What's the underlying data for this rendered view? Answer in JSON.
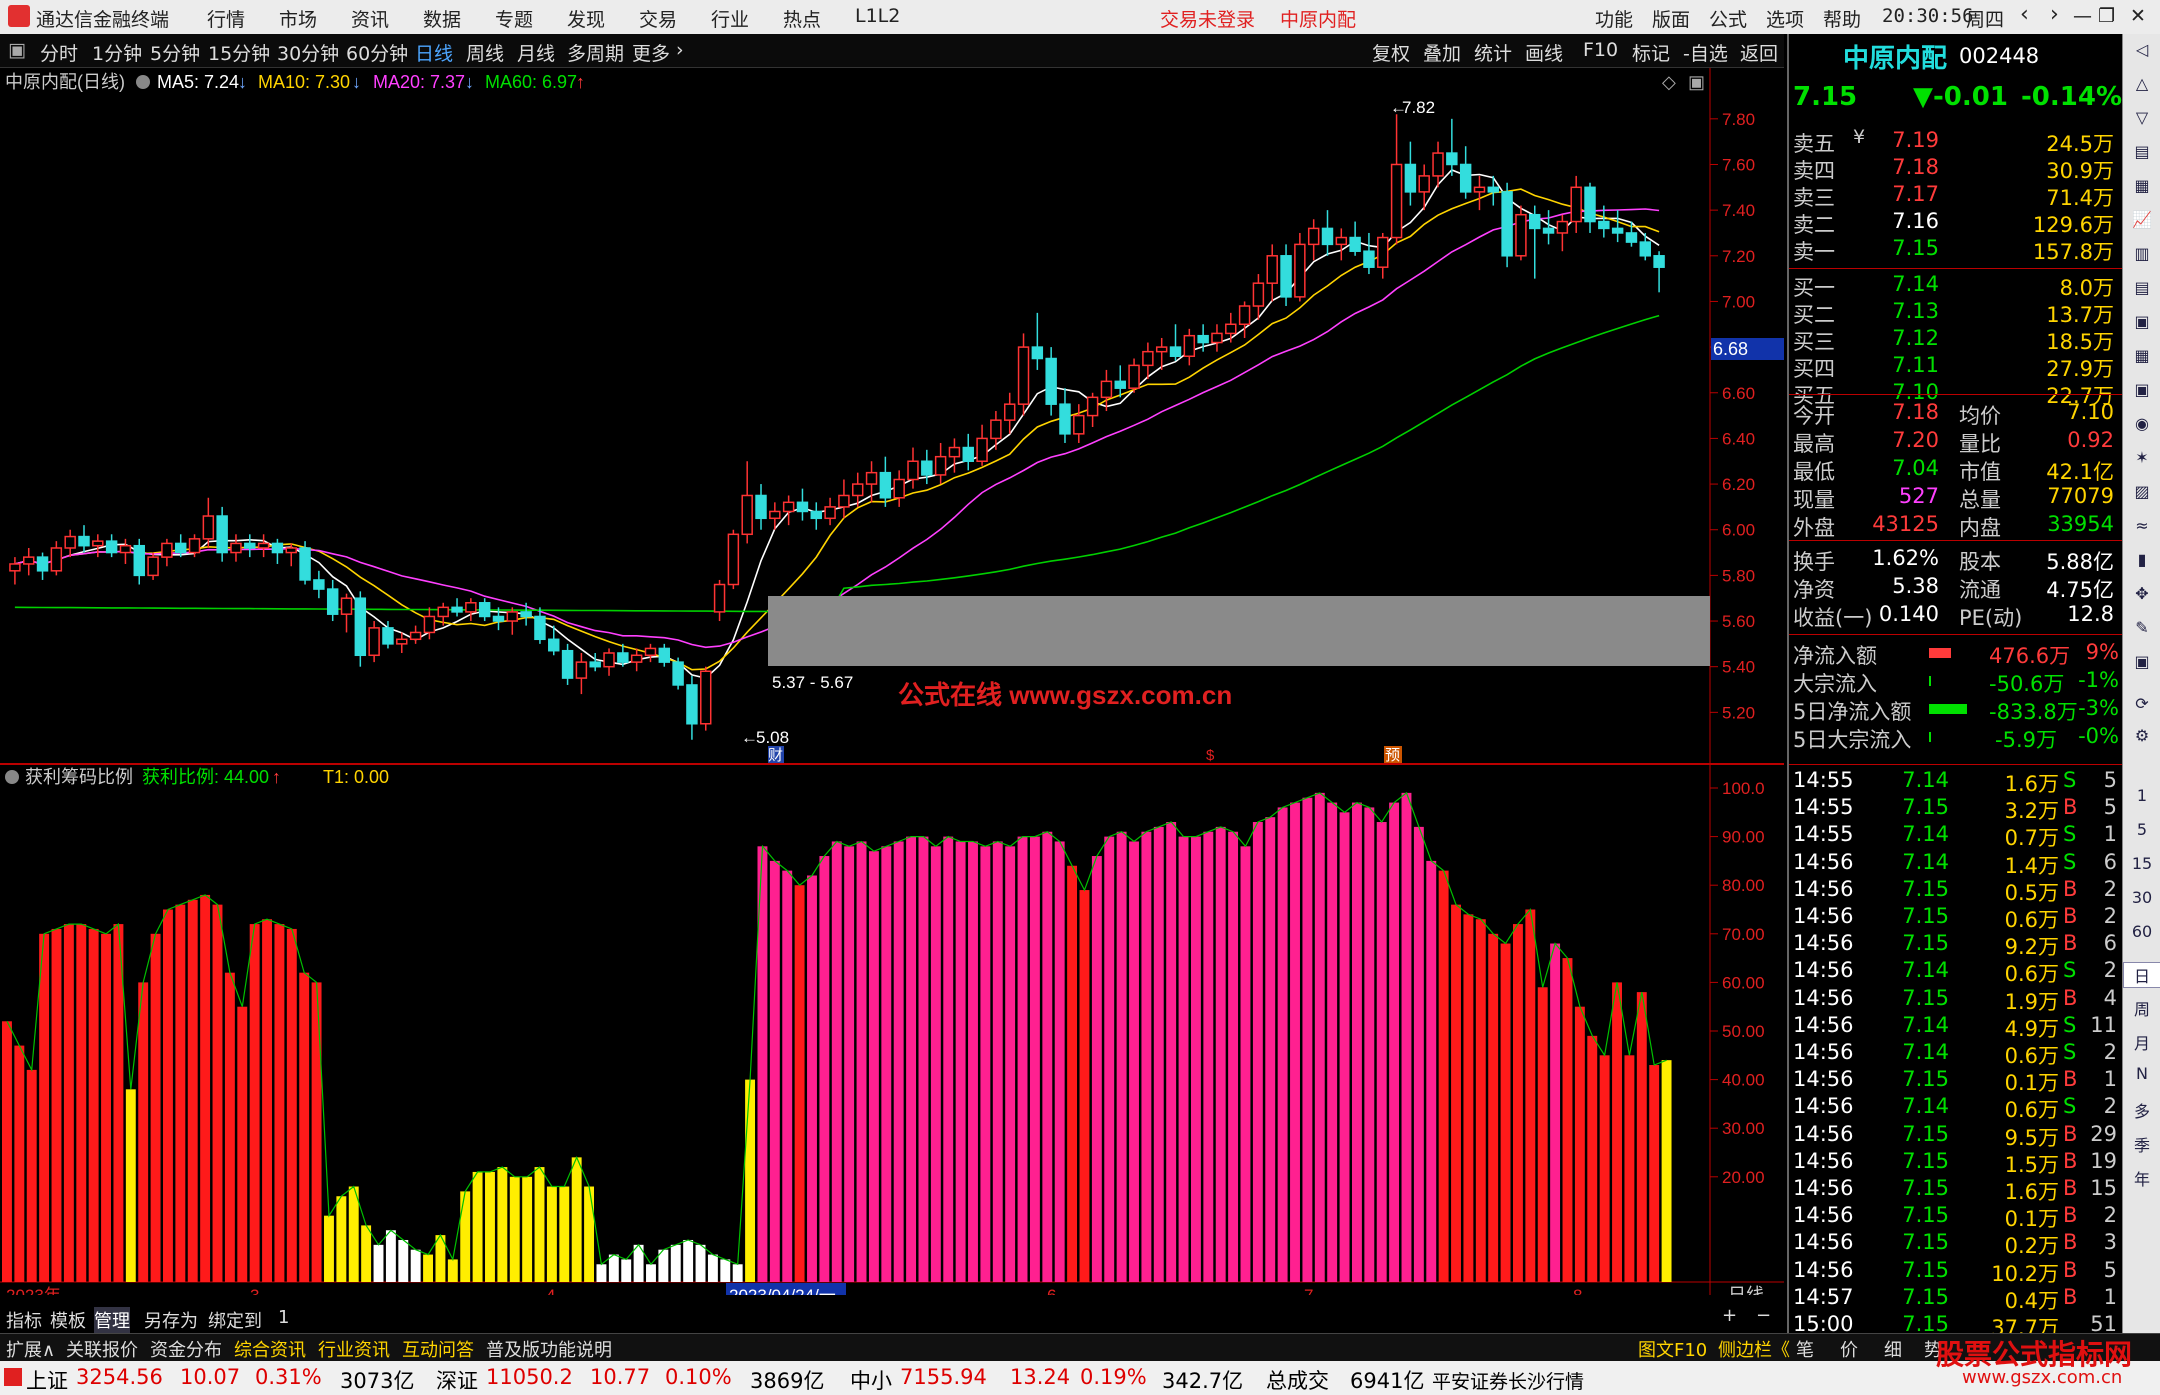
{
  "app": {
    "title": "通达信金融终端",
    "menus": [
      "行情",
      "市场",
      "资讯",
      "数据",
      "专题",
      "发现",
      "交易",
      "行业",
      "热点",
      "L1L2"
    ],
    "login": "交易未登录",
    "stock_name_title": "中原内配",
    "right_menus": [
      "功能",
      "版面",
      "公式",
      "选项",
      "帮助"
    ],
    "time": "20:30:56",
    "weekday": "周四"
  },
  "periods": [
    "分时",
    "1分钟",
    "5分钟",
    "15分钟",
    "30分钟",
    "60分钟",
    "日线",
    "周线",
    "月线",
    "多周期",
    "更多"
  ],
  "active_period": "日线",
  "chart_buttons": [
    "复权",
    "叠加",
    "统计",
    "画线",
    "F10",
    "标记",
    "-自选",
    "返回"
  ],
  "ma_legend": {
    "name": "中原内配(日线)",
    "ma5": "MA5: 7.24",
    "ma10": "MA10: 7.30",
    "ma20": "MA20: 7.37",
    "ma60": "MA60: 6.97"
  },
  "price_axis": [
    "7.80",
    "7.60",
    "7.40",
    "7.20",
    "7.00",
    "6.80",
    "6.60",
    "6.40",
    "6.20",
    "6.00",
    "5.80",
    "5.60",
    "5.40",
    "5.20"
  ],
  "price_marker": "6.68",
  "annotations": {
    "high": "7.82",
    "low": "5.08",
    "range": "5.37 - 5.67",
    "watermark": "公式在线  www.gszx.com.cn",
    "markers": [
      "财",
      "$",
      "预"
    ]
  },
  "indicator": {
    "name": "获利筹码比例",
    "value": "获利比例: 44.00",
    "t1": "T1: 0.00",
    "axis": [
      "100.0",
      "90.00",
      "80.00",
      "70.00",
      "60.00",
      "50.00",
      "40.00",
      "30.00",
      "20.00"
    ]
  },
  "date_axis": {
    "labels": [
      "2023年",
      "3",
      "4",
      "2023/04/24/一",
      "6",
      "7",
      "8"
    ],
    "period": "日线"
  },
  "chart_bottom_tabs": [
    "指标",
    "模板",
    "管理",
    "另存为",
    "绑定到",
    "1"
  ],
  "chart_data": {
    "type": "candlestick",
    "title": "中原内配(日线)",
    "ylim": [
      5.0,
      7.9
    ],
    "candles": [
      [
        5.82,
        5.88,
        5.76,
        5.85
      ],
      [
        5.85,
        5.92,
        5.8,
        5.88
      ],
      [
        5.88,
        5.9,
        5.78,
        5.82
      ],
      [
        5.82,
        5.95,
        5.8,
        5.92
      ],
      [
        5.92,
        6.0,
        5.88,
        5.97
      ],
      [
        5.97,
        6.02,
        5.9,
        5.93
      ],
      [
        5.93,
        5.98,
        5.88,
        5.95
      ],
      [
        5.95,
        5.98,
        5.88,
        5.9
      ],
      [
        5.9,
        5.96,
        5.85,
        5.93
      ],
      [
        5.93,
        5.96,
        5.76,
        5.8
      ],
      [
        5.8,
        5.9,
        5.78,
        5.88
      ],
      [
        5.88,
        5.96,
        5.84,
        5.94
      ],
      [
        5.94,
        5.98,
        5.88,
        5.9
      ],
      [
        5.9,
        5.98,
        5.88,
        5.96
      ],
      [
        5.96,
        6.14,
        5.92,
        6.06
      ],
      [
        6.06,
        6.1,
        5.86,
        5.9
      ],
      [
        5.9,
        5.98,
        5.86,
        5.94
      ],
      [
        5.94,
        5.98,
        5.88,
        5.92
      ],
      [
        5.92,
        5.98,
        5.88,
        5.94
      ],
      [
        5.94,
        5.96,
        5.85,
        5.9
      ],
      [
        5.9,
        5.94,
        5.84,
        5.92
      ],
      [
        5.92,
        5.95,
        5.76,
        5.78
      ],
      [
        5.78,
        5.82,
        5.7,
        5.74
      ],
      [
        5.74,
        5.78,
        5.6,
        5.63
      ],
      [
        5.63,
        5.72,
        5.55,
        5.7
      ],
      [
        5.7,
        5.73,
        5.4,
        5.45
      ],
      [
        5.45,
        5.6,
        5.42,
        5.57
      ],
      [
        5.57,
        5.6,
        5.48,
        5.5
      ],
      [
        5.5,
        5.55,
        5.46,
        5.52
      ],
      [
        5.52,
        5.58,
        5.5,
        5.55
      ],
      [
        5.55,
        5.66,
        5.52,
        5.62
      ],
      [
        5.62,
        5.68,
        5.58,
        5.66
      ],
      [
        5.66,
        5.7,
        5.62,
        5.64
      ],
      [
        5.64,
        5.7,
        5.6,
        5.68
      ],
      [
        5.68,
        5.7,
        5.6,
        5.62
      ],
      [
        5.62,
        5.66,
        5.56,
        5.6
      ],
      [
        5.6,
        5.66,
        5.54,
        5.64
      ],
      [
        5.64,
        5.68,
        5.58,
        5.62
      ],
      [
        5.62,
        5.66,
        5.5,
        5.52
      ],
      [
        5.52,
        5.58,
        5.45,
        5.47
      ],
      [
        5.47,
        5.5,
        5.32,
        5.35
      ],
      [
        5.35,
        5.46,
        5.28,
        5.42
      ],
      [
        5.42,
        5.46,
        5.38,
        5.4
      ],
      [
        5.4,
        5.48,
        5.36,
        5.46
      ],
      [
        5.46,
        5.5,
        5.4,
        5.42
      ],
      [
        5.42,
        5.48,
        5.38,
        5.45
      ],
      [
        5.45,
        5.5,
        5.42,
        5.48
      ],
      [
        5.48,
        5.5,
        5.4,
        5.42
      ],
      [
        5.42,
        5.44,
        5.3,
        5.32
      ],
      [
        5.32,
        5.36,
        5.08,
        5.15
      ],
      [
        5.15,
        5.4,
        5.12,
        5.38
      ],
      [
        5.64,
        5.78,
        5.6,
        5.76
      ],
      [
        5.76,
        6.0,
        5.74,
        5.98
      ],
      [
        5.98,
        6.3,
        5.94,
        6.15
      ],
      [
        6.15,
        6.2,
        6.0,
        6.05
      ],
      [
        6.05,
        6.12,
        6.0,
        6.08
      ],
      [
        6.08,
        6.15,
        6.02,
        6.12
      ],
      [
        6.12,
        6.18,
        6.04,
        6.08
      ],
      [
        6.08,
        6.12,
        6.0,
        6.05
      ],
      [
        6.05,
        6.14,
        6.02,
        6.1
      ],
      [
        6.1,
        6.22,
        6.05,
        6.15
      ],
      [
        6.15,
        6.25,
        6.1,
        6.2
      ],
      [
        6.2,
        6.3,
        6.12,
        6.25
      ],
      [
        6.25,
        6.32,
        6.1,
        6.14
      ],
      [
        6.14,
        6.26,
        6.1,
        6.22
      ],
      [
        6.22,
        6.36,
        6.18,
        6.3
      ],
      [
        6.3,
        6.35,
        6.2,
        6.24
      ],
      [
        6.24,
        6.38,
        6.2,
        6.32
      ],
      [
        6.32,
        6.4,
        6.25,
        6.36
      ],
      [
        6.36,
        6.42,
        6.26,
        6.3
      ],
      [
        6.3,
        6.46,
        6.28,
        6.4
      ],
      [
        6.4,
        6.52,
        6.35,
        6.48
      ],
      [
        6.48,
        6.6,
        6.42,
        6.55
      ],
      [
        6.55,
        6.86,
        6.5,
        6.8
      ],
      [
        6.8,
        6.95,
        6.7,
        6.75
      ],
      [
        6.75,
        6.8,
        6.5,
        6.55
      ],
      [
        6.55,
        6.62,
        6.38,
        6.42
      ],
      [
        6.42,
        6.55,
        6.38,
        6.5
      ],
      [
        6.5,
        6.6,
        6.45,
        6.58
      ],
      [
        6.58,
        6.7,
        6.52,
        6.65
      ],
      [
        6.65,
        6.72,
        6.58,
        6.62
      ],
      [
        6.62,
        6.75,
        6.6,
        6.72
      ],
      [
        6.72,
        6.82,
        6.66,
        6.78
      ],
      [
        6.78,
        6.84,
        6.7,
        6.8
      ],
      [
        6.8,
        6.9,
        6.74,
        6.76
      ],
      [
        6.76,
        6.88,
        6.72,
        6.85
      ],
      [
        6.85,
        6.9,
        6.78,
        6.82
      ],
      [
        6.82,
        6.9,
        6.78,
        6.86
      ],
      [
        6.86,
        6.95,
        6.82,
        6.9
      ],
      [
        6.9,
        7.0,
        6.84,
        6.98
      ],
      [
        6.98,
        7.12,
        6.92,
        7.08
      ],
      [
        7.08,
        7.25,
        7.0,
        7.2
      ],
      [
        7.2,
        7.25,
        6.98,
        7.02
      ],
      [
        7.02,
        7.3,
        7.0,
        7.25
      ],
      [
        7.25,
        7.36,
        7.18,
        7.32
      ],
      [
        7.32,
        7.4,
        7.2,
        7.25
      ],
      [
        7.25,
        7.32,
        7.18,
        7.28
      ],
      [
        7.28,
        7.35,
        7.2,
        7.22
      ],
      [
        7.22,
        7.3,
        7.12,
        7.15
      ],
      [
        7.15,
        7.3,
        7.1,
        7.28
      ],
      [
        7.28,
        7.82,
        7.25,
        7.6
      ],
      [
        7.6,
        7.7,
        7.42,
        7.48
      ],
      [
        7.48,
        7.6,
        7.4,
        7.55
      ],
      [
        7.55,
        7.7,
        7.5,
        7.65
      ],
      [
        7.65,
        7.8,
        7.55,
        7.6
      ],
      [
        7.6,
        7.68,
        7.45,
        7.48
      ],
      [
        7.48,
        7.55,
        7.4,
        7.5
      ],
      [
        7.5,
        7.55,
        7.42,
        7.48
      ],
      [
        7.48,
        7.52,
        7.15,
        7.2
      ],
      [
        7.2,
        7.42,
        7.18,
        7.38
      ],
      [
        7.38,
        7.42,
        7.1,
        7.32
      ],
      [
        7.32,
        7.4,
        7.25,
        7.3
      ],
      [
        7.3,
        7.38,
        7.22,
        7.35
      ],
      [
        7.35,
        7.55,
        7.3,
        7.5
      ],
      [
        7.5,
        7.52,
        7.3,
        7.35
      ],
      [
        7.35,
        7.42,
        7.28,
        7.32
      ],
      [
        7.32,
        7.4,
        7.26,
        7.3
      ],
      [
        7.3,
        7.35,
        7.24,
        7.26
      ],
      [
        7.26,
        7.3,
        7.18,
        7.2
      ],
      [
        7.2,
        7.22,
        7.04,
        7.15
      ]
    ],
    "indicator_values": [
      52,
      47,
      42,
      70,
      71,
      72,
      72,
      71,
      70,
      72,
      38,
      60,
      70,
      75,
      76,
      77,
      78,
      76,
      62,
      55,
      72,
      73,
      72,
      71,
      62,
      60,
      12,
      16,
      18,
      10,
      6,
      9,
      7,
      5,
      4,
      8,
      3,
      17,
      21,
      21,
      22,
      20,
      20,
      22,
      18,
      18,
      24,
      18,
      2,
      4,
      3,
      6,
      2,
      5,
      6,
      7,
      6,
      4,
      3,
      2,
      40,
      88,
      85,
      83,
      80,
      82,
      86,
      89,
      88,
      89,
      87,
      88,
      89,
      90,
      90,
      88,
      90,
      89,
      89,
      88,
      89,
      88,
      90,
      90,
      91,
      89,
      84,
      79,
      86,
      90,
      91,
      89,
      91,
      92,
      93,
      90,
      90,
      91,
      92,
      91,
      88,
      93,
      94,
      96,
      97,
      98,
      99,
      97,
      95,
      97,
      96,
      93,
      97,
      99,
      92,
      85,
      83,
      76,
      74,
      73,
      70,
      68,
      72,
      75,
      59,
      68,
      65,
      55,
      49,
      45,
      60,
      45,
      58,
      43,
      44
    ],
    "indicator_colors": [
      "r",
      "r",
      "r",
      "r",
      "r",
      "r",
      "r",
      "r",
      "r",
      "r",
      "y",
      "r",
      "r",
      "r",
      "r",
      "r",
      "r",
      "r",
      "r",
      "r",
      "r",
      "r",
      "r",
      "r",
      "r",
      "r",
      "y",
      "y",
      "y",
      "y",
      "w",
      "w",
      "w",
      "w",
      "y",
      "y",
      "y",
      "y",
      "y",
      "y",
      "y",
      "y",
      "y",
      "y",
      "y",
      "y",
      "y",
      "y",
      "w",
      "w",
      "w",
      "w",
      "w",
      "w",
      "w",
      "w",
      "w",
      "w",
      "w",
      "w",
      "y",
      "m",
      "m",
      "m",
      "r",
      "m",
      "m",
      "m",
      "m",
      "m",
      "m",
      "m",
      "m",
      "m",
      "m",
      "m",
      "m",
      "m",
      "m",
      "m",
      "m",
      "m",
      "m",
      "m",
      "m",
      "m",
      "r",
      "r",
      "m",
      "m",
      "m",
      "m",
      "m",
      "m",
      "m",
      "m",
      "m",
      "m",
      "m",
      "m",
      "m",
      "m",
      "m",
      "m",
      "m",
      "m",
      "m",
      "m",
      "m",
      "m",
      "m",
      "m",
      "m",
      "m",
      "m",
      "m",
      "r",
      "r",
      "r",
      "r",
      "r",
      "r",
      "r",
      "r",
      "r",
      "m",
      "r",
      "r",
      "r",
      "r",
      "r",
      "r",
      "r",
      "r",
      "y",
      "y"
    ]
  },
  "quote": {
    "name": "中原内配",
    "code": "002448",
    "price": "7.15",
    "change": "▼-0.01",
    "pct": "-0.14%",
    "asks": [
      [
        "卖五",
        "7.19",
        "24.5万"
      ],
      [
        "卖四",
        "7.18",
        "30.9万"
      ],
      [
        "卖三",
        "7.17",
        "71.4万"
      ],
      [
        "卖二",
        "7.16",
        "129.6万"
      ],
      [
        "卖一",
        "7.15",
        "157.8万"
      ]
    ],
    "bids": [
      [
        "买一",
        "7.14",
        "8.0万"
      ],
      [
        "买二",
        "7.13",
        "13.7万"
      ],
      [
        "买三",
        "7.12",
        "18.5万"
      ],
      [
        "买四",
        "7.11",
        "27.9万"
      ],
      [
        "买五",
        "7.10",
        "22.7万"
      ]
    ],
    "ask5_mark": "¥",
    "stats": [
      [
        "今开",
        "7.18",
        "均价",
        "7.10"
      ],
      [
        "最高",
        "7.20",
        "量比",
        "0.92"
      ],
      [
        "最低",
        "7.04",
        "市值",
        "42.1亿"
      ],
      [
        "现量",
        "527",
        "总量",
        "77079"
      ],
      [
        "外盘",
        "43125",
        "内盘",
        "33954"
      ]
    ],
    "fund": [
      [
        "换手",
        "1.62%",
        "股本",
        "5.88亿"
      ],
      [
        "净资",
        "5.38",
        "流通",
        "4.75亿"
      ],
      [
        "收益(一)",
        "0.140",
        "PE(动)",
        "12.8"
      ]
    ],
    "flows": [
      [
        "净流入额",
        "476.6万",
        "9%"
      ],
      [
        "大宗流入",
        "-50.6万",
        "-1%"
      ],
      [
        "5日净流入额",
        "-833.8万",
        "-3%"
      ],
      [
        "5日大宗流入",
        "-5.9万",
        "-0%"
      ]
    ],
    "ticks": [
      [
        "14:55",
        "7.14",
        "1.6万",
        "S",
        "5"
      ],
      [
        "14:55",
        "7.15",
        "3.2万",
        "B",
        "5"
      ],
      [
        "14:55",
        "7.14",
        "0.7万",
        "S",
        "1"
      ],
      [
        "14:56",
        "7.14",
        "1.4万",
        "S",
        "6"
      ],
      [
        "14:56",
        "7.15",
        "0.5万",
        "B",
        "2"
      ],
      [
        "14:56",
        "7.15",
        "0.6万",
        "B",
        "2"
      ],
      [
        "14:56",
        "7.15",
        "9.2万",
        "B",
        "6"
      ],
      [
        "14:56",
        "7.14",
        "0.6万",
        "S",
        "2"
      ],
      [
        "14:56",
        "7.15",
        "1.9万",
        "B",
        "4"
      ],
      [
        "14:56",
        "7.14",
        "4.9万",
        "S",
        "11"
      ],
      [
        "14:56",
        "7.14",
        "0.6万",
        "S",
        "2"
      ],
      [
        "14:56",
        "7.15",
        "0.1万",
        "B",
        "1"
      ],
      [
        "14:56",
        "7.14",
        "0.6万",
        "S",
        "2"
      ],
      [
        "14:56",
        "7.15",
        "9.5万",
        "B",
        "29"
      ],
      [
        "14:56",
        "7.15",
        "1.5万",
        "B",
        "19"
      ],
      [
        "14:56",
        "7.15",
        "1.6万",
        "B",
        "15"
      ],
      [
        "14:56",
        "7.15",
        "0.1万",
        "B",
        "2"
      ],
      [
        "14:56",
        "7.15",
        "0.2万",
        "B",
        "3"
      ],
      [
        "14:56",
        "7.15",
        "10.2万",
        "B",
        "5"
      ],
      [
        "14:57",
        "7.15",
        "0.4万",
        "B",
        "1"
      ],
      [
        "15:00",
        "7.15",
        "37.7万",
        "",
        "51"
      ]
    ],
    "tabs": [
      "笔",
      "价",
      "细",
      "势"
    ]
  },
  "rightbar": [
    "1",
    "5",
    "15",
    "30",
    "60",
    "日",
    "周",
    "月",
    "N",
    "多",
    "季",
    "年"
  ],
  "bottom_tabs": [
    "扩展∧",
    "关联报价",
    "资金分布",
    "综合资讯",
    "行业资讯",
    "互动问答",
    "普及版功能说明"
  ],
  "bottom_right": [
    "图文F10",
    "侧边栏《"
  ],
  "status": {
    "sh": [
      "上证",
      "3254.56",
      "10.07",
      "0.31%",
      "3073亿"
    ],
    "sz": [
      "深证",
      "11050.2",
      "10.77",
      "0.10%",
      "3869亿"
    ],
    "zx": [
      "中小",
      "7155.94",
      "13.24",
      "0.19%",
      "342.7亿"
    ],
    "total": [
      "总成交",
      "6941亿"
    ],
    "broker": "平安证券长沙行情",
    "logo1": "股票公式指标网",
    "logo2": "www.gszx.com.cn"
  }
}
